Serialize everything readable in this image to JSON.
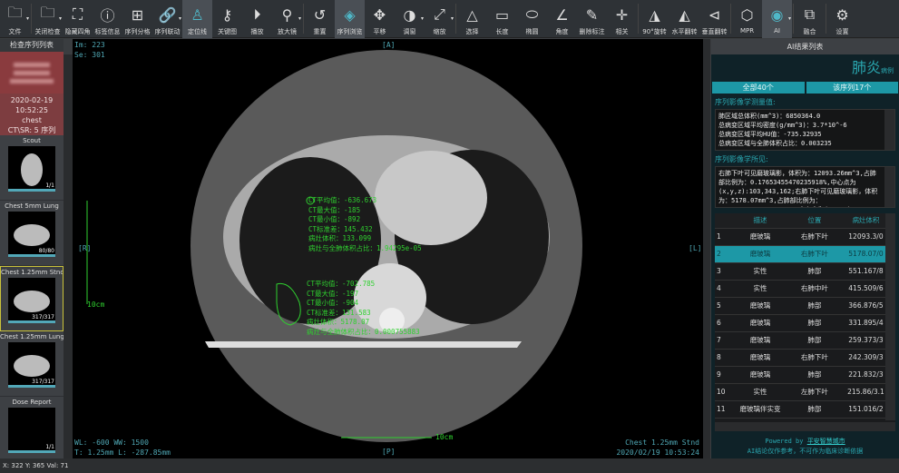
{
  "toolbar": [
    {
      "label": "文件",
      "icon": "folder-icon",
      "dd": true
    },
    {
      "label": "关闭检查",
      "icon": "close-folder-icon",
      "dd": true
    },
    {
      "label": "隐藏四角",
      "icon": "corners-icon"
    },
    {
      "label": "标签信息",
      "icon": "info-icon"
    },
    {
      "label": "序列分格",
      "icon": "grid-icon"
    },
    {
      "label": "序列联动",
      "icon": "link-icon",
      "dd": true
    },
    {
      "label": "定位线",
      "icon": "locator-icon",
      "active": true
    },
    {
      "label": "关键图",
      "icon": "key-icon"
    },
    {
      "label": "播放",
      "icon": "play-icon"
    },
    {
      "label": "放大镜",
      "icon": "magnifier-icon",
      "dd": true
    },
    {
      "label": "重置",
      "icon": "reset-icon"
    },
    {
      "label": "序列浏览",
      "icon": "layers-icon",
      "active": true
    },
    {
      "label": "平移",
      "icon": "pan-icon"
    },
    {
      "label": "调窗",
      "icon": "window-level-icon",
      "dd": true
    },
    {
      "label": "缩放",
      "icon": "zoom-icon",
      "dd": true
    },
    {
      "label": "选择",
      "icon": "select-icon"
    },
    {
      "label": "长度",
      "icon": "ruler-icon"
    },
    {
      "label": "椭圆",
      "icon": "ellipse-icon"
    },
    {
      "label": "角度",
      "icon": "angle-icon"
    },
    {
      "label": "删除标注",
      "icon": "delete-annotation-icon"
    },
    {
      "label": "相关",
      "icon": "crosshair-icon"
    },
    {
      "label": "90°旋转",
      "icon": "rotate-icon"
    },
    {
      "label": "水平翻转",
      "icon": "flip-horizontal-icon"
    },
    {
      "label": "垂直翻转",
      "icon": "flip-vertical-icon"
    },
    {
      "label": "MPR",
      "icon": "mpr-icon"
    },
    {
      "label": "AI",
      "icon": "ai-eye-icon",
      "active": true,
      "dd": true
    },
    {
      "label": "融合",
      "icon": "fusion-icon"
    },
    {
      "label": "设置",
      "icon": "settings-icon"
    }
  ],
  "left": {
    "title": "检查序列列表",
    "study": {
      "date": "2020-02-19",
      "time": "10:52:25",
      "part": "chest",
      "modality": "CT\\SR: 5 序列"
    },
    "series": [
      {
        "name": "Scout",
        "count": "1/1"
      },
      {
        "name": "Chest 5mm Lung",
        "count": "80/80"
      },
      {
        "name": "Chest 1.25mm Stnd",
        "count": "317/317",
        "selected": true
      },
      {
        "name": "Chest 1.25mm Lung",
        "count": "317/317"
      },
      {
        "name": "Dose Report",
        "count": "1/1"
      }
    ]
  },
  "viewer": {
    "im": "Im: 223",
    "se": "Se: 301",
    "top": "[A]",
    "bottom": "[P]",
    "left": "[R]",
    "right": "[L]",
    "wl": "WL: -600 WW: 1500",
    "thick": "T: 1.25mm L: -287.85mm",
    "series": "Chest 1.25mm Stnd",
    "datetime": "2020/02/19 10:53:24",
    "scale": "10cm",
    "ann1": [
      "CT平均值：-636.673",
      "CT最大值：-185",
      "CT最小值：-892",
      "CT标准差：145.432",
      "病灶体积：133.099",
      "病灶与全肺体积占比：1.94295e-05"
    ],
    "ann2": [
      "CT平均值：-702.785",
      "CT最大值：-197",
      "CT最小值：-904",
      "CT标准差：131.583",
      "病灶体积：5178.07",
      "病灶与全肺体积占比：0.000755883"
    ]
  },
  "ai": {
    "title": "AI结果列表",
    "diagnosis": "肺炎",
    "diagnosis_suffix": "病例",
    "all": "全部40个",
    "series_count": "该序列17个",
    "measure_title": "序列影像学测量值:",
    "measures": [
      "肺区域总体积(mm^3)：6850364.0",
      "总病变区域平均密度(g/mm^3)：3.7*10^-6",
      "总病变区域平均HU值：-735.32935",
      "总病变区域与全肺体积占比：0.003235"
    ],
    "findings_title": "序列影像学所见:",
    "findings": "右肺下叶可见磨玻璃影，体积为：12093.26mm^3,占肺部比例为：0.1765345547023591​8%,中心点为(x,y,z):103,343,162;右肺下叶可见磨玻璃影，体积为：5178.07mm^3,占肺部比例为：0.07558827518615902%,中心点为(x,y,z):",
    "columns": [
      "描述",
      "位置",
      "病灶体积"
    ],
    "rows": [
      [
        "1",
        "磨玻璃",
        "右肺下叶",
        "12093.3/0"
      ],
      [
        "2",
        "磨玻璃",
        "右肺下叶",
        "5178.07/0"
      ],
      [
        "3",
        "实性",
        "肺部",
        "551.167/8"
      ],
      [
        "4",
        "实性",
        "右肺中叶",
        "415.509/6"
      ],
      [
        "5",
        "磨玻璃",
        "肺部",
        "366.876/5"
      ],
      [
        "6",
        "磨玻璃",
        "肺部",
        "331.895/4"
      ],
      [
        "7",
        "磨玻璃",
        "肺部",
        "259.373/3"
      ],
      [
        "8",
        "磨玻璃",
        "右肺下叶",
        "242.309/3"
      ],
      [
        "9",
        "磨玻璃",
        "肺部",
        "221.832/3"
      ],
      [
        "10",
        "实性",
        "左肺下叶",
        "215.86/3.1"
      ],
      [
        "11",
        "磨玻璃伴实变",
        "肺部",
        "151.016/2"
      ]
    ],
    "selected_row": 2,
    "powered": "Powered by",
    "company": "平安智慧城市",
    "disclaimer": "AI结论仅作参考，不可作为临床诊断依据"
  },
  "status": "X: 322 Y: 365 Val: 71",
  "colors": {
    "accent": "#1d98a6",
    "annotation": "#2fd02f",
    "overlay": "#4fa7b4"
  }
}
